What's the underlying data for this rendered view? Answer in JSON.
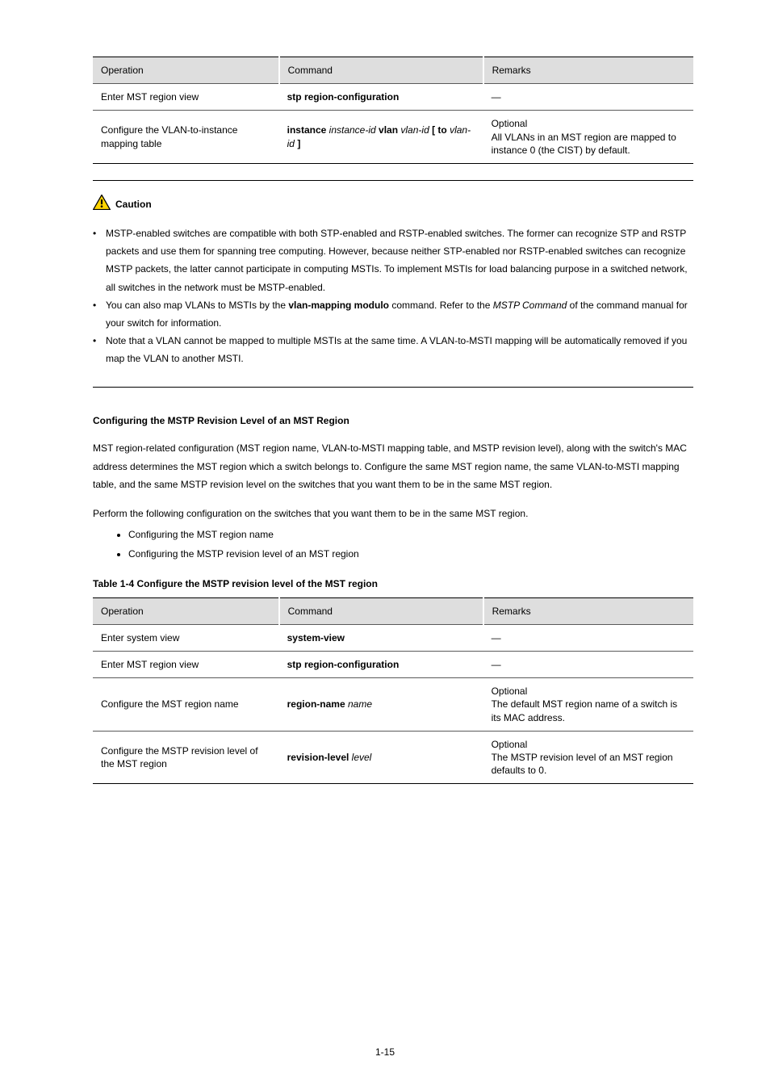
{
  "table1": {
    "headers": [
      "Operation",
      "Command",
      "Remarks"
    ],
    "rows": [
      {
        "op": "Enter MST region view",
        "cmd": [
          {
            "t": "stp region-configuration",
            "b": true
          }
        ],
        "rem": "—"
      },
      {
        "op": "Configure the VLAN-to-instance mapping table",
        "cmd": [
          {
            "t": "instance ",
            "b": true
          },
          {
            "t": "instance-id ",
            "i": true
          },
          {
            "t": "vlan ",
            "b": true
          },
          {
            "t": "vlan-id ",
            "i": true
          },
          {
            "t": "[ ",
            "b": true
          },
          {
            "t": "to ",
            "b": true
          },
          {
            "t": "vlan-id ",
            "i": true
          },
          {
            "t": "]",
            "b": true
          }
        ],
        "rem": "Optional\nAll VLANs in an MST region are mapped to instance 0 (the CIST) by default."
      }
    ]
  },
  "caution": {
    "label": "Caution",
    "bullets": [
      "MSTP-enabled switches are compatible with both STP-enabled and RSTP-enabled switches. The former can recognize STP and RSTP packets and use them for spanning tree computing. However, because neither STP-enabled nor RSTP-enabled switches can recognize MSTP packets, the latter cannot participate in computing MSTIs. To implement MSTIs for load balancing purpose in a switched network, all switches in the network must be MSTP-enabled.",
      {
        "pre": "You can also map VLANs to MSTIs by the ",
        "cmdBold": "vlan-mapping modulo",
        "post": " command. Refer to the ",
        "ital": "MSTP Command",
        "postItal": " of the command manual for your switch for information."
      },
      "Note that a VLAN cannot be mapped to multiple MSTIs at the same time. A VLAN-to-MSTI mapping will be automatically removed if you map the VLAN to another MSTI."
    ]
  },
  "section": {
    "title": "Configuring the MSTP Revision Level of an MST Region",
    "p1": "MST region-related configuration (MST region name, VLAN-to-MSTI mapping table, and MSTP revision level), along with the switch's MAC address determines the MST region which a switch belongs to. Configure the same MST region name, the same VLAN-to-MSTI mapping table, and the same MSTP revision level on the switches that you want them to be in the same MST region.",
    "listLead": "Perform the following configuration on the switches that you want them to be in the same MST region.",
    "bullets": [
      "Configuring the MST region name",
      "Configuring the MSTP revision level of an MST region"
    ],
    "caption": "Table 1-4 Configure the MSTP revision level of the MST region"
  },
  "table2": {
    "headers": [
      "Operation",
      "Command",
      "Remarks"
    ],
    "rows": [
      {
        "op": "Enter system view",
        "cmd": [
          {
            "t": "system-view",
            "b": true
          }
        ],
        "rem": "—"
      },
      {
        "op": "Enter MST region view",
        "cmd": [
          {
            "t": "stp region-configuration",
            "b": true
          }
        ],
        "rem": "—"
      },
      {
        "op": "Configure the MST region name",
        "cmd": [
          {
            "t": "region-name ",
            "b": true
          },
          {
            "t": "name",
            "i": true
          }
        ],
        "rem": "Optional\nThe default MST region name of a switch is its MAC address."
      },
      {
        "op": "Configure the MSTP revision level of the MST region",
        "cmd": [
          {
            "t": "revision-level ",
            "b": true
          },
          {
            "t": "level",
            "i": true
          }
        ],
        "rem": "Optional\nThe MSTP revision level of an MST region defaults to 0."
      }
    ]
  },
  "pageNumber": "1-15"
}
